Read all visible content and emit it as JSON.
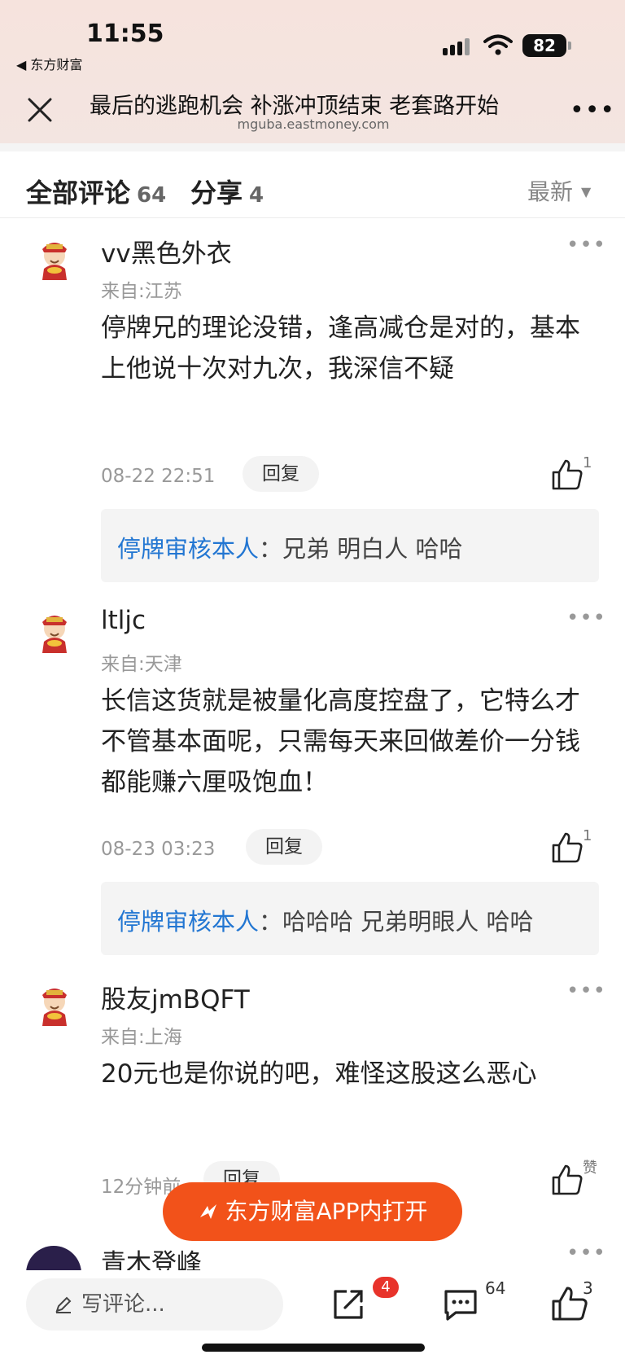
{
  "status_bar": {
    "time": "11:55",
    "back_app": "◀ 东方财富",
    "battery": "82"
  },
  "header": {
    "title": "最后的逃跑机会 补涨冲顶结束 老套路开始",
    "url": "mguba.eastmoney.com"
  },
  "tabs": {
    "comments_label": "全部评论",
    "comments_count": "64",
    "share_label": "分享",
    "share_count": "4",
    "sort_label": "最新"
  },
  "comments": [
    {
      "name": "vv黑色外衣",
      "location": "来自:江苏",
      "body": "停牌兄的理论没错，逢高减仓是对的，基本上他说十次对九次，我深信不疑",
      "date": "08-22 22:51",
      "reply_label": "回复",
      "likes": "1",
      "reply": {
        "author": "停牌审核本人",
        "text": "：兄弟  明白人  哈哈"
      }
    },
    {
      "name": "ltljc",
      "location": "来自:天津",
      "body": "长信这货就是被量化高度控盘了，它特么才不管基本面呢，只需每天来回做差价一分钱都能赚六厘吸饱血！",
      "date": "08-23 03:23",
      "reply_label": "回复",
      "likes": "1",
      "reply": {
        "author": "停牌审核本人",
        "text": "：哈哈哈  兄弟明眼人  哈哈"
      }
    },
    {
      "name": "股友jmBQFT",
      "location": "来自:上海",
      "body": "20元也是你说的吧，难怪这股这么恶心",
      "date": "12分钟前",
      "reply_label": "回复",
      "likes": "赞"
    },
    {
      "name": "青木登峰"
    }
  ],
  "open_app_label": "东方财富APP内打开",
  "bottom_bar": {
    "write_placeholder": "写评论...",
    "share_badge": "4",
    "comment_count": "64",
    "like_count": "3"
  },
  "colors": {
    "accent": "#f2521a",
    "link": "#2276d2",
    "badge": "#e8332b"
  }
}
